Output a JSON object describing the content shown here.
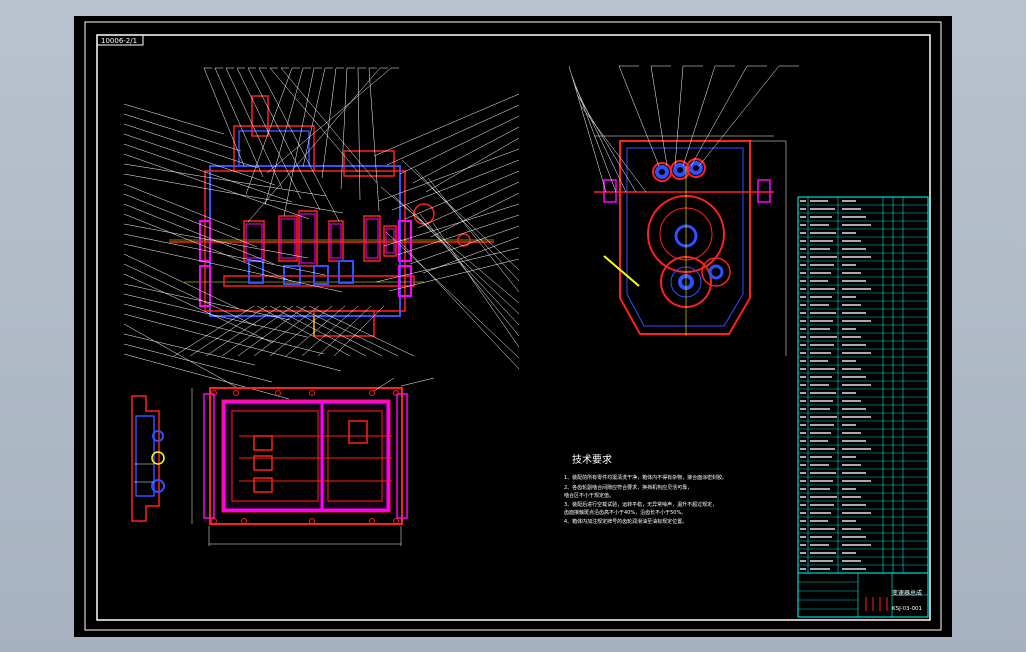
{
  "drawing": {
    "sheet_label": "10006-2/1",
    "colors": {
      "background": "#000000",
      "frame": "#ffffff",
      "section": "#ff2020",
      "outline": "#3050ff",
      "hatch": "#ff00ff",
      "center": "#ffff00",
      "table": "#00ffff",
      "leader": "#ffffff"
    },
    "tech_requirements": {
      "title": "技术要求",
      "lines": [
        "1、装配前所有零件均需清洗干净，箱体内不得有杂物，接合面涂密封胶。",
        "2、各齿轮副啮合间隙应符合要求，换挡机构应灵活可靠，",
        "啮合区不小于规定值。",
        "3、装配后进行空载试验，运转平稳，无异常噪声，温升不超过规定，",
        "齿面接触斑点沿齿高不小于40%，沿齿长不小于50%。",
        "4、箱体内加注规定牌号的齿轮润滑油至油标规定位置。"
      ]
    },
    "title_block": {
      "name": "变速器总成",
      "number": "KSJ-03-001"
    }
  }
}
